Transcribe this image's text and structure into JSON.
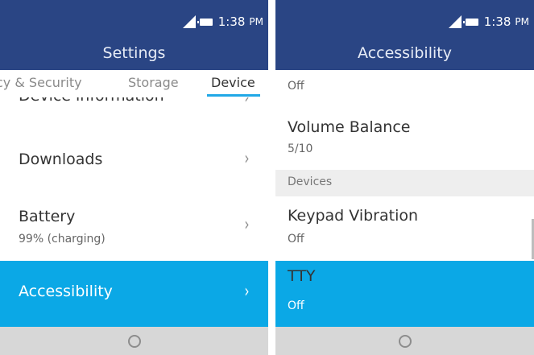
{
  "left_screen": {
    "status": {
      "time": "1:38",
      "ampm": "PM",
      "signal_icon": "signal-icon",
      "battery_icon": "battery-icon"
    },
    "title": "Settings",
    "tabs": [
      {
        "label": "cy & Security",
        "selected": false
      },
      {
        "label": "Storage",
        "selected": false
      },
      {
        "label": "Device",
        "selected": true
      }
    ],
    "items": [
      {
        "title": "Device information",
        "subtitle": "",
        "highlighted": false
      },
      {
        "title": "Downloads",
        "subtitle": "",
        "highlighted": false
      },
      {
        "title": "Battery",
        "subtitle": "99% (charging)",
        "highlighted": false
      },
      {
        "title": "Accessibility",
        "subtitle": "",
        "highlighted": true
      }
    ],
    "chevron": "›",
    "softkey_icon": "circle-select-icon"
  },
  "right_screen": {
    "status": {
      "time": "1:38",
      "ampm": "PM",
      "signal_icon": "signal-icon",
      "battery_icon": "battery-icon"
    },
    "title": "Accessibility",
    "top_value": "Off",
    "items": [
      {
        "title": "Volume Balance",
        "value": "5/10",
        "highlighted": false
      },
      {
        "title": "Keypad Vibration",
        "value": "Off",
        "highlighted": false
      },
      {
        "title": "TTY",
        "value": "Off",
        "highlighted": true
      }
    ],
    "section_header": "Devices",
    "softkey_icon": "circle-select-icon"
  },
  "colors": {
    "header": "#2a4584",
    "highlight": "#0ba8e6",
    "tab_underline": "#21a8e6",
    "softkey_bar": "#d7d7d7",
    "section_bg": "#eeeeee"
  }
}
